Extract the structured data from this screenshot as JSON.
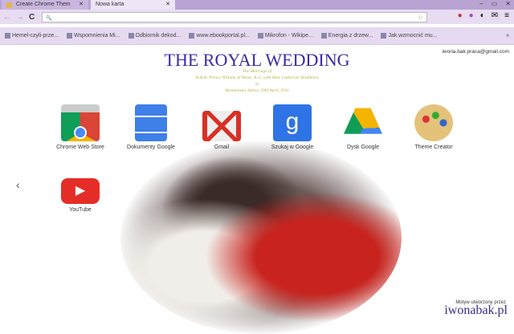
{
  "tabs": [
    {
      "label": "Create Chrome Them"
    },
    {
      "label": "Nowa karta"
    }
  ],
  "window_controls": [
    "–",
    "▭",
    "✕"
  ],
  "toolbar": {
    "back": "←",
    "forward": "→",
    "reload": "C",
    "search_icon": "🔍",
    "url": ""
  },
  "bookmarks": [
    "Hemel-czyli-prze...",
    "Wspomnienia Mi...",
    "Odbiornik dekod...",
    "www.ebookportal.pl...",
    "Mikrofon - Wikipe...",
    "Energia z drzew...",
    "Jak wzmocnić mu..."
  ],
  "bookmarks_more": "»",
  "header": {
    "title": "THE ROYAL WEDDING",
    "line1": "The Marriage of",
    "line2": "H.R.H. Prince William of Wales, K.G. with Miss Catherine Middleton",
    "line3": "at",
    "line4": "Westminster Abbey, 29th April, 2011"
  },
  "email": "iwona.bak.praca@gmail.com",
  "apps": [
    {
      "label": "Chrome Web Store"
    },
    {
      "label": "Dokumenty Google"
    },
    {
      "label": "Gmail"
    },
    {
      "label": "Szukaj w Google"
    },
    {
      "label": "Dysk Google"
    },
    {
      "label": "Theme Creator"
    },
    {
      "label": "YouTube"
    }
  ],
  "prev_arrow": "‹",
  "footer": {
    "credit": "Motyw utworzony przez",
    "site": "iwonabak.pl"
  }
}
